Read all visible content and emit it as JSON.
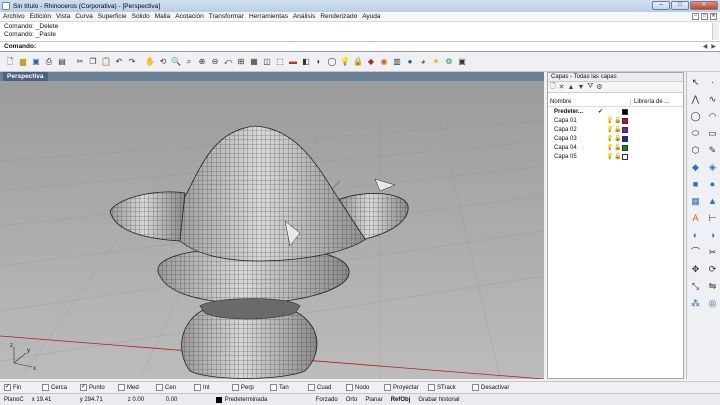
{
  "window": {
    "title": "Sin título - Rhinoceros (Corporativa) - [Perspectiva]"
  },
  "menu": [
    "Archivo",
    "Edición",
    "Vista",
    "Curva",
    "Superficie",
    "Sólido",
    "Malla",
    "Acotación",
    "Transformar",
    "Herramientas",
    "Análisis",
    "Renderizado",
    "Ayuda"
  ],
  "history": [
    "Comando: _Delete",
    "Comando: _Paste"
  ],
  "command": {
    "label": "Comando:"
  },
  "viewport": {
    "name": "Perspectiva"
  },
  "layers": {
    "title": "Capas - Todas las capas",
    "col_name": "Nombre",
    "col_material": "Librería de ...",
    "rows": [
      {
        "name": "Predeter...",
        "current": true,
        "color": "#000000"
      },
      {
        "name": "Capa 01",
        "current": false,
        "color": "#d01010"
      },
      {
        "name": "Capa 02",
        "current": false,
        "color": "#6a2aa8"
      },
      {
        "name": "Capa 03",
        "current": false,
        "color": "#1428c8"
      },
      {
        "name": "Capa 04",
        "current": false,
        "color": "#1a8a1a"
      },
      {
        "name": "Capa 05",
        "current": false,
        "color": "#ffffff"
      }
    ]
  },
  "osnaps": [
    {
      "label": "Fin",
      "checked": true
    },
    {
      "label": "Cerca",
      "checked": false
    },
    {
      "label": "Punto",
      "checked": true
    },
    {
      "label": "Med",
      "checked": false
    },
    {
      "label": "Cen",
      "checked": false
    },
    {
      "label": "Int",
      "checked": false
    },
    {
      "label": "Perp",
      "checked": false
    },
    {
      "label": "Tan",
      "checked": false
    },
    {
      "label": "Cuad",
      "checked": false
    },
    {
      "label": "Nodo",
      "checked": false
    },
    {
      "label": "Proyectar",
      "checked": false
    },
    {
      "label": "STrack",
      "checked": false
    },
    {
      "label": "Desactivar",
      "checked": false
    }
  ],
  "status": {
    "cplane": "PlanoC",
    "x": "x 19.41",
    "y": "y 294.71",
    "z": "z 0.00",
    "dist": "0.00",
    "layer": "Predeterminada",
    "toggles": [
      "Forzado",
      "Orto",
      "Planar",
      "RefObj",
      "Grabar historial"
    ]
  },
  "axis_label": {
    "x": "x",
    "y": "y",
    "z": "z"
  }
}
